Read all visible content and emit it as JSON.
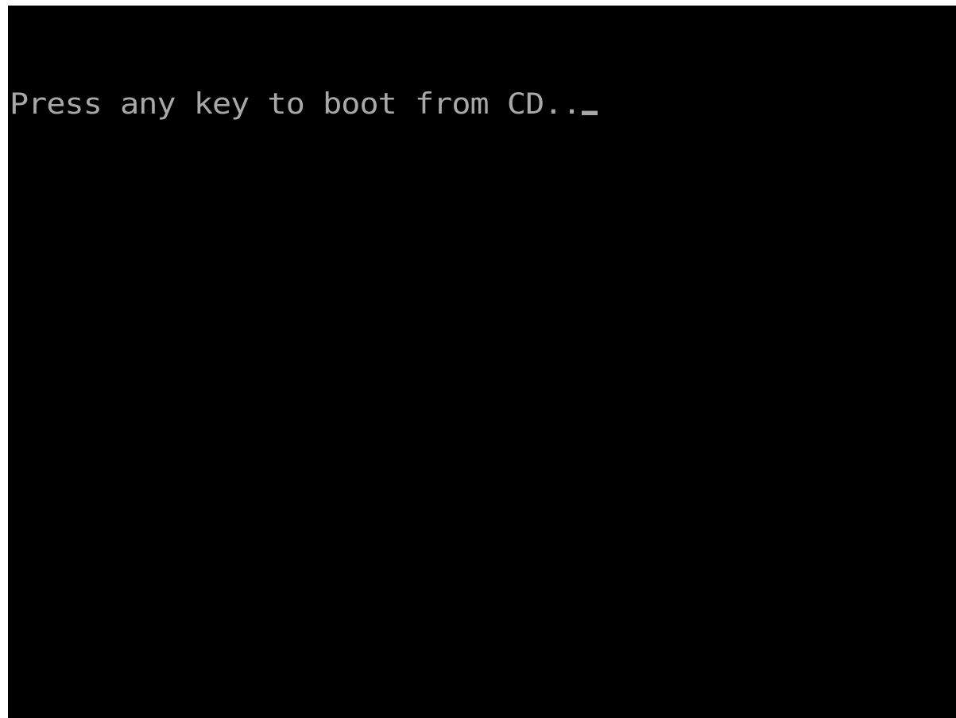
{
  "screen": {
    "message": "Press any key to boot from CD..",
    "cursor_icon": "underscore-block-cursor",
    "background_color": "#000000",
    "text_color": "#a8a8a8"
  }
}
